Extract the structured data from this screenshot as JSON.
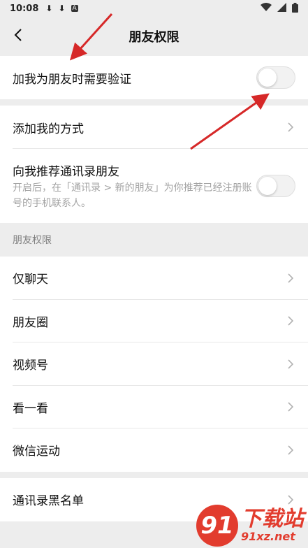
{
  "status": {
    "time": "10:08",
    "icons": [
      "download-icon",
      "download-icon",
      "a-icon"
    ]
  },
  "nav": {
    "title": "朋友权限"
  },
  "verify": {
    "label": "加我为朋友时需要验证",
    "enabled": false
  },
  "add_methods": {
    "label": "添加我的方式"
  },
  "recommend": {
    "label": "向我推荐通讯录朋友",
    "desc": "开启后，在「通讯录 > 新的朋友」为你推荐已经注册账号的手机联系人。",
    "enabled": false
  },
  "section": {
    "title": "朋友权限"
  },
  "permissions": [
    {
      "label": "仅聊天"
    },
    {
      "label": "朋友圈"
    },
    {
      "label": "视频号"
    },
    {
      "label": "看一看"
    },
    {
      "label": "微信运动"
    }
  ],
  "blacklist": {
    "label": "通讯录黑名单"
  },
  "watermark": {
    "logo": "91",
    "top": "下载站",
    "sub": "91xz.net"
  },
  "colors": {
    "annotation": "#d62828",
    "watermark": "#e23c2e"
  }
}
